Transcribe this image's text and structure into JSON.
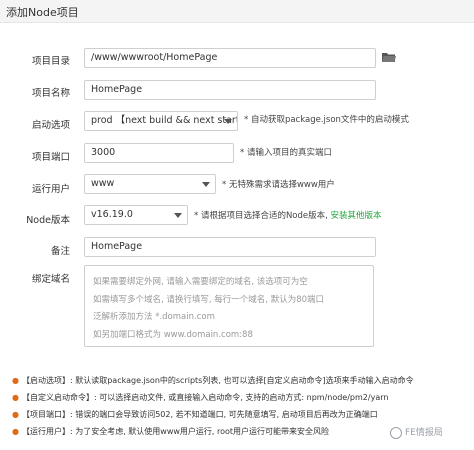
{
  "title": "添加Node项目",
  "form": {
    "project_dir": {
      "label": "项目目录",
      "value": "/www/wwwroot/HomePage"
    },
    "project_name": {
      "label": "项目名称",
      "value": "HomePage"
    },
    "start_option": {
      "label": "启动选项",
      "value": "prod 【next build && next start】",
      "hint": "* 自动获取package.json文件中的启动模式"
    },
    "project_port": {
      "label": "项目端口",
      "value": "3000",
      "hint": "* 请输入项目的真实端口"
    },
    "run_user": {
      "label": "运行用户",
      "value": "www",
      "hint": "* 无特殊需求请选择www用户"
    },
    "node_version": {
      "label": "Node版本",
      "value": "v16.19.0",
      "hint": "* 请根据项目选择合适的Node版本,",
      "hint_link": "安装其他版本"
    },
    "remark": {
      "label": "备注",
      "value": "HomePage"
    },
    "domain": {
      "label": "绑定域名",
      "placeholder_lines": [
        "如果需要绑定外网, 请输入需要绑定的域名, 该选项可为空",
        "如需填写多个域名, 请换行填写, 每行一个域名, 默认为80端口",
        "泛解析添加方法 *.domain.com",
        "如另加端口格式为 www.domain.com:88"
      ]
    }
  },
  "notes": [
    "【启动选项】: 默认读取package.json中的scripts列表, 也可以选择[自定义启动命令]选项来手动输入启动命令",
    "【自定义启动命令】: 可以选择启动文件, 或直接输入启动命令, 支持的启动方式: npm/node/pm2/yarn",
    "【项目端口】: 错误的端口会导致访问502, 若不知道端口, 可先随意填写, 启动项目后再改为正确端口",
    "【运行用户】: 为了安全考虑, 默认使用www用户运行, root用户运行可能带来安全风险"
  ],
  "watermark": "FE情报局",
  "colors": {
    "accent_green": "#20a53a",
    "bullet_orange": "#e06b16"
  },
  "icons": {
    "folder": "folder-icon",
    "dropdown": "chevron-down-icon"
  }
}
